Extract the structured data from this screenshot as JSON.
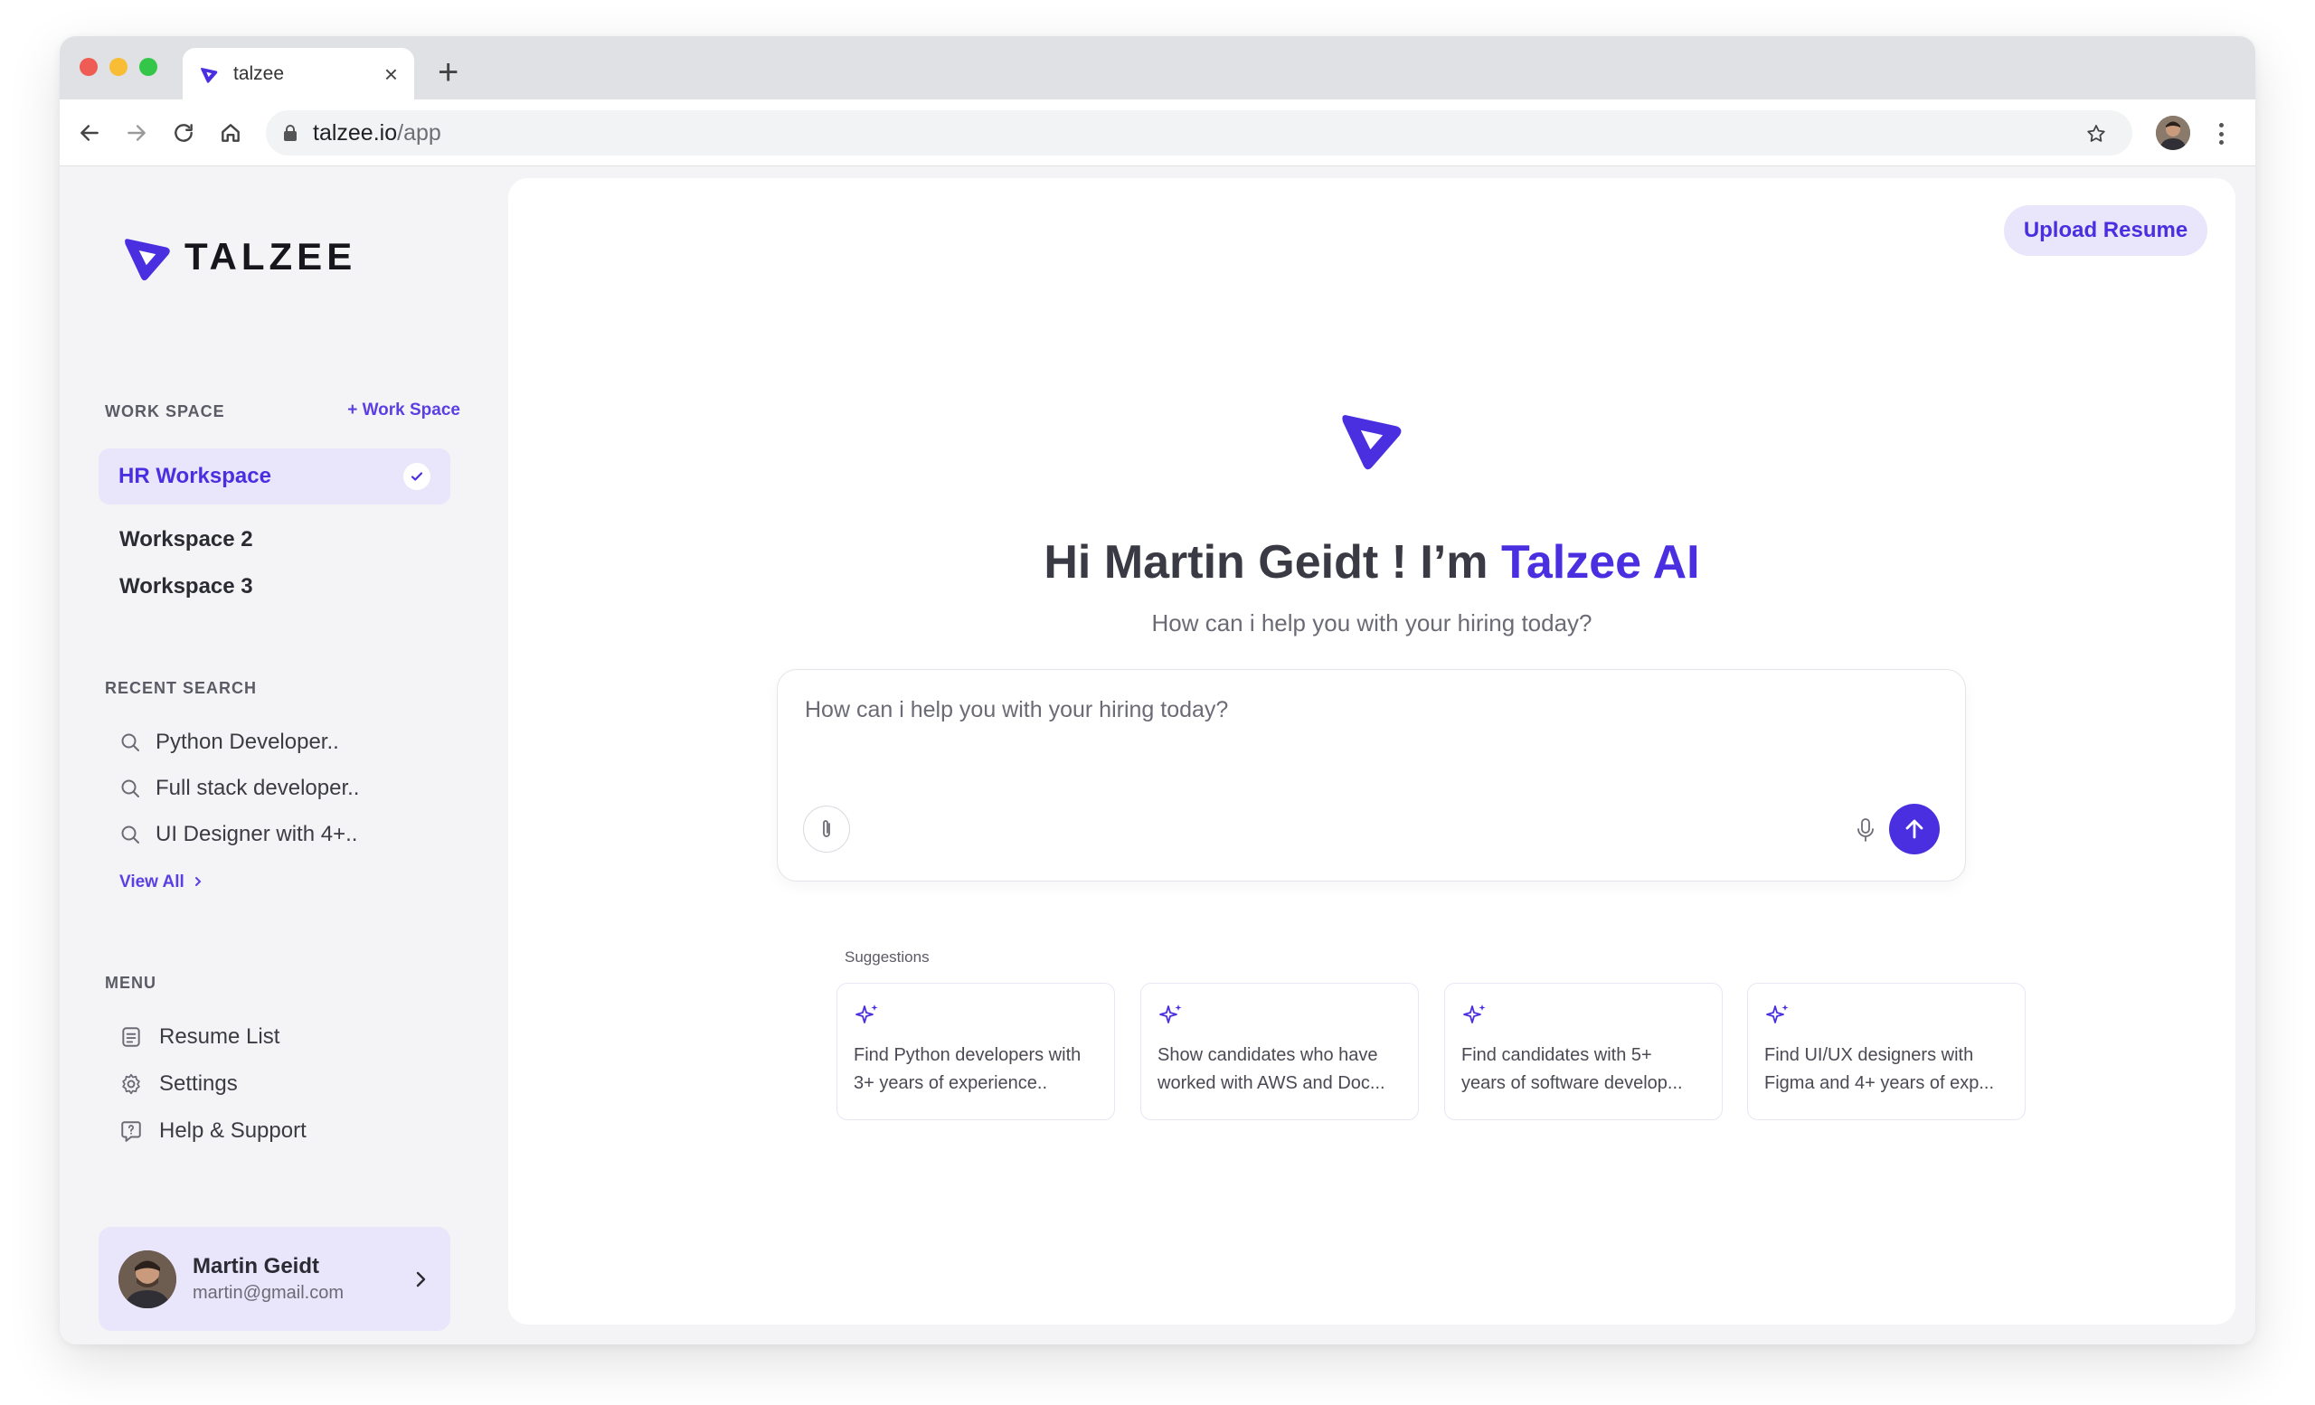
{
  "browser": {
    "tab_title": "talzee",
    "new_tab": "+",
    "close": "×",
    "url_host": "talzee.io",
    "url_path": "/app"
  },
  "brand": {
    "name": "TALZEE",
    "accent_color": "#4a2fe0"
  },
  "sidebar": {
    "workspace_title": "WORK SPACE",
    "add_workspace": "+ Work Space",
    "workspaces": [
      {
        "label": "HR Workspace",
        "active": true
      },
      {
        "label": "Workspace 2"
      },
      {
        "label": "Workspace 3"
      }
    ],
    "recent_title": "RECENT SEARCH",
    "recent": [
      {
        "label": "Python Developer..",
        "icon": "search-icon"
      },
      {
        "label": "Full stack developer..",
        "icon": "search-icon"
      },
      {
        "label": "UI Designer with 4+..",
        "icon": "search-icon"
      }
    ],
    "view_all": "View All",
    "menu_title": "MENU",
    "menu": [
      {
        "label": "Resume List",
        "icon": "document-icon"
      },
      {
        "label": "Settings",
        "icon": "gear-icon"
      },
      {
        "label": "Help & Support",
        "icon": "help-icon"
      }
    ],
    "user": {
      "name": "Martin Geidt",
      "email": "martin@gmail.com"
    }
  },
  "main": {
    "upload_button": "Upload Resume",
    "greeting_prefix": "Hi Martin Geidt ! I’m",
    "greeting_accent": "Talzee AI",
    "subtitle": "How can i help you with your hiring today?",
    "chat_placeholder": "How can i help you with your hiring today?",
    "suggestions_title": "Suggestions",
    "suggestions": [
      {
        "line1": "Find Python developers with",
        "line2": "3+ years of experience.."
      },
      {
        "line1": "Show candidates who have",
        "line2": "worked with AWS and Doc..."
      },
      {
        "line1": "Find candidates with 5+",
        "line2": "years of software develop..."
      },
      {
        "line1": "Find UI/UX designers with",
        "line2": "Figma and 4+ years of exp..."
      }
    ]
  }
}
